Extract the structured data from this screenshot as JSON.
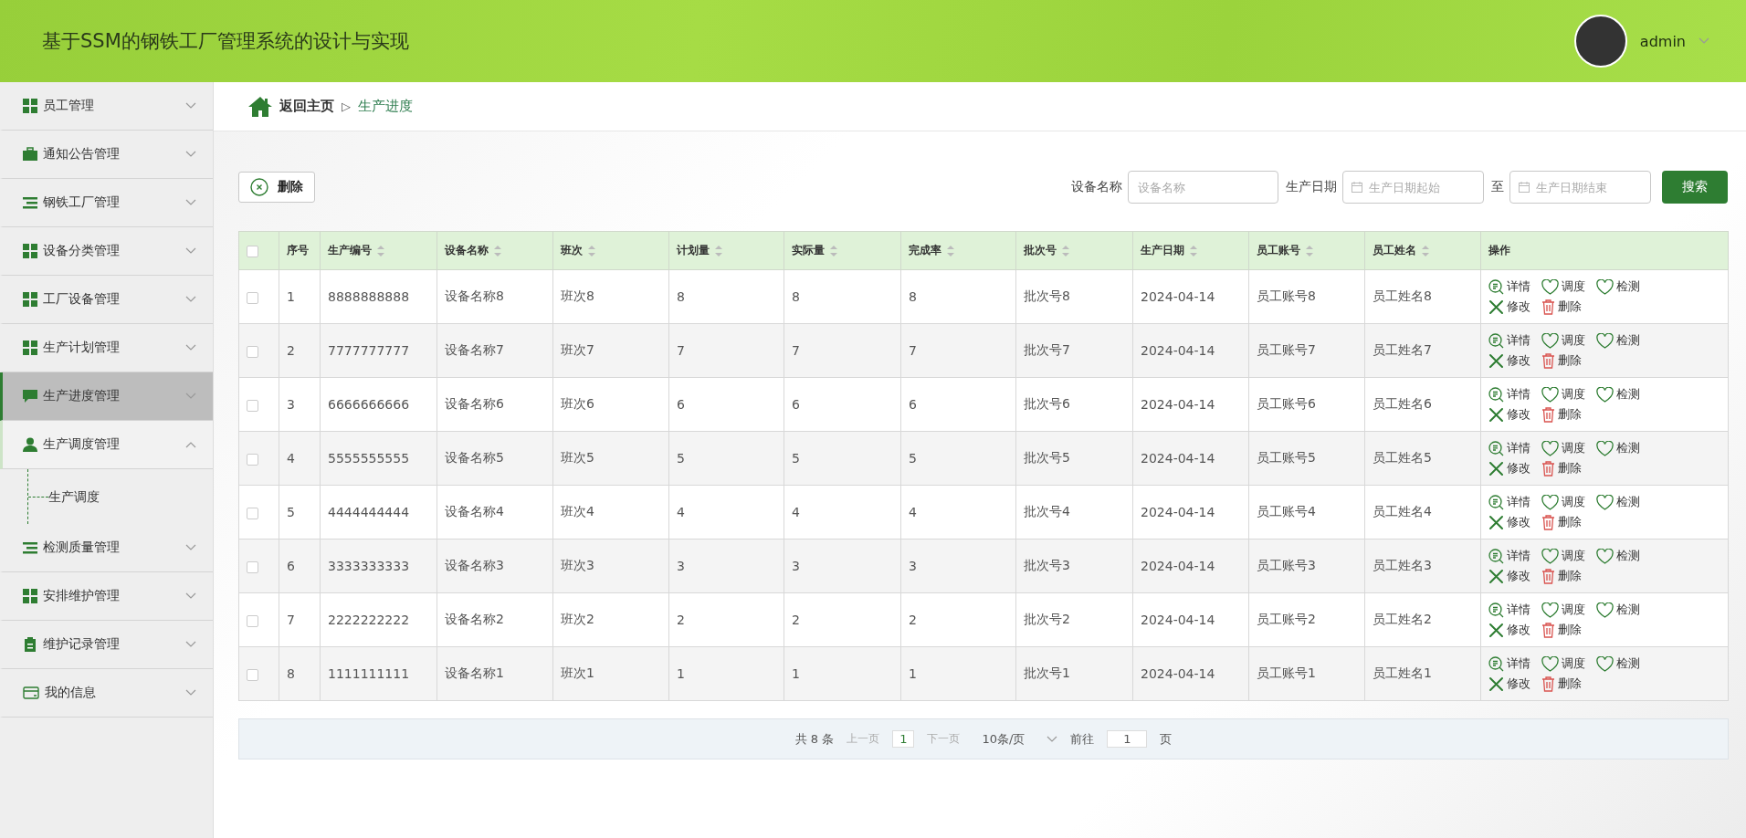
{
  "header": {
    "title": "基于SSM的钢铁工厂管理系统的设计与实现",
    "user": "admin"
  },
  "sidebar": {
    "items": [
      {
        "label": "员工管理",
        "selected": false,
        "expanded": false
      },
      {
        "label": "通知公告管理",
        "selected": false,
        "expanded": false
      },
      {
        "label": "钢铁工厂管理",
        "selected": false,
        "expanded": false
      },
      {
        "label": "设备分类管理",
        "selected": false,
        "expanded": false
      },
      {
        "label": "工厂设备管理",
        "selected": false,
        "expanded": false
      },
      {
        "label": "生产计划管理",
        "selected": false,
        "expanded": false
      },
      {
        "label": "生产进度管理",
        "selected": true,
        "expanded": false
      },
      {
        "label": "生产调度管理",
        "selected": false,
        "expanded": true,
        "children": [
          {
            "label": "生产调度"
          }
        ]
      },
      {
        "label": "检测质量管理",
        "selected": false,
        "expanded": false
      },
      {
        "label": "安排维护管理",
        "selected": false,
        "expanded": false
      },
      {
        "label": "维护记录管理",
        "selected": false,
        "expanded": false
      },
      {
        "label": "我的信息",
        "selected": false,
        "expanded": false
      }
    ]
  },
  "breadcrumb": {
    "home": "返回主页",
    "separator": "▷",
    "current": "生产进度"
  },
  "toolbar": {
    "delete": "删除",
    "filters": [
      {
        "label": "设备名称",
        "placeholder": "设备名称",
        "kind": "text"
      },
      {
        "label": "生产日期",
        "placeholder": "生产日期起始",
        "kind": "date"
      },
      {
        "label": "至",
        "placeholder": "生产日期结束",
        "kind": "date"
      }
    ],
    "search": "搜索"
  },
  "table": {
    "all_checked": false,
    "columns": [
      {
        "label": "序号",
        "sortable": false
      },
      {
        "label": "生产编号",
        "sortable": true
      },
      {
        "label": "设备名称",
        "sortable": true
      },
      {
        "label": "班次",
        "sortable": true
      },
      {
        "label": "计划量",
        "sortable": true
      },
      {
        "label": "实际量",
        "sortable": true
      },
      {
        "label": "完成率",
        "sortable": true
      },
      {
        "label": "批次号",
        "sortable": true
      },
      {
        "label": "生产日期",
        "sortable": true
      },
      {
        "label": "员工账号",
        "sortable": true
      },
      {
        "label": "员工姓名",
        "sortable": true
      },
      {
        "label": "操作",
        "sortable": false
      }
    ],
    "rows": [
      {
        "checked": false,
        "cells": [
          "1",
          "8888888888",
          "设备名称8",
          "班次8",
          "8",
          "8",
          "8",
          "批次号8",
          "2024-04-14",
          "员工账号8",
          "员工姓名8"
        ],
        "actions": [
          "详情",
          "调度",
          "检测",
          "修改",
          "删除"
        ]
      },
      {
        "checked": false,
        "cells": [
          "2",
          "7777777777",
          "设备名称7",
          "班次7",
          "7",
          "7",
          "7",
          "批次号7",
          "2024-04-14",
          "员工账号7",
          "员工姓名7"
        ],
        "actions": [
          "详情",
          "调度",
          "检测",
          "修改",
          "删除"
        ]
      },
      {
        "checked": false,
        "cells": [
          "3",
          "6666666666",
          "设备名称6",
          "班次6",
          "6",
          "6",
          "6",
          "批次号6",
          "2024-04-14",
          "员工账号6",
          "员工姓名6"
        ],
        "actions": [
          "详情",
          "调度",
          "检测",
          "修改",
          "删除"
        ]
      },
      {
        "checked": false,
        "cells": [
          "4",
          "5555555555",
          "设备名称5",
          "班次5",
          "5",
          "5",
          "5",
          "批次号5",
          "2024-04-14",
          "员工账号5",
          "员工姓名5"
        ],
        "actions": [
          "详情",
          "调度",
          "检测",
          "修改",
          "删除"
        ]
      },
      {
        "checked": false,
        "cells": [
          "5",
          "4444444444",
          "设备名称4",
          "班次4",
          "4",
          "4",
          "4",
          "批次号4",
          "2024-04-14",
          "员工账号4",
          "员工姓名4"
        ],
        "actions": [
          "详情",
          "调度",
          "检测",
          "修改",
          "删除"
        ]
      },
      {
        "checked": false,
        "cells": [
          "6",
          "3333333333",
          "设备名称3",
          "班次3",
          "3",
          "3",
          "3",
          "批次号3",
          "2024-04-14",
          "员工账号3",
          "员工姓名3"
        ],
        "actions": [
          "详情",
          "调度",
          "检测",
          "修改",
          "删除"
        ]
      },
      {
        "checked": false,
        "cells": [
          "7",
          "2222222222",
          "设备名称2",
          "班次2",
          "2",
          "2",
          "2",
          "批次号2",
          "2024-04-14",
          "员工账号2",
          "员工姓名2"
        ],
        "actions": [
          "详情",
          "调度",
          "检测",
          "修改",
          "删除"
        ]
      },
      {
        "checked": false,
        "cells": [
          "8",
          "1111111111",
          "设备名称1",
          "班次1",
          "1",
          "1",
          "1",
          "批次号1",
          "2024-04-14",
          "员工账号1",
          "员工姓名1"
        ],
        "actions": [
          "详情",
          "调度",
          "检测",
          "修改",
          "删除"
        ]
      }
    ]
  },
  "pagination": {
    "total": "共 8 条",
    "prev": {
      "label": "上一页",
      "disabled": true
    },
    "page": "1",
    "next": {
      "label": "下一页",
      "disabled": true
    },
    "size": "10条/页",
    "goto": "前往",
    "goto_value": "1",
    "goto_suffix": "页"
  }
}
